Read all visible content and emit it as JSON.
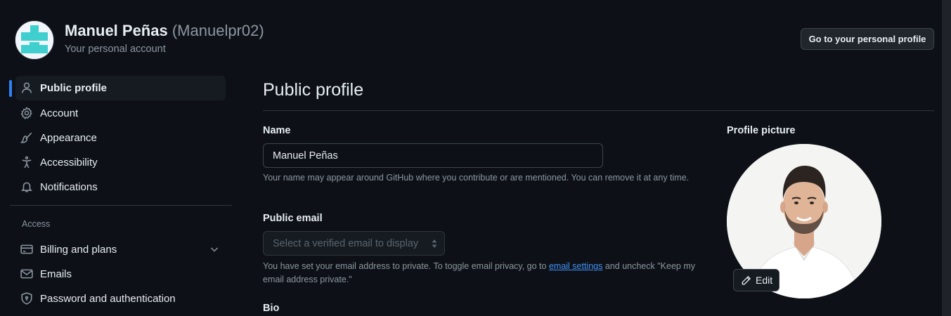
{
  "account": {
    "display_name": "Manuel Peñas",
    "login": "(Manuelpr02)",
    "subtitle": "Your personal account",
    "go_to_profile_label": "Go to your personal profile"
  },
  "sidebar": {
    "items": [
      {
        "label": "Public profile",
        "icon": "person-icon",
        "active": true
      },
      {
        "label": "Account",
        "icon": "gear-icon"
      },
      {
        "label": "Appearance",
        "icon": "paintbrush-icon"
      },
      {
        "label": "Accessibility",
        "icon": "accessibility-icon"
      },
      {
        "label": "Notifications",
        "icon": "bell-icon"
      }
    ],
    "access_heading": "Access",
    "access_items": [
      {
        "label": "Billing and plans",
        "icon": "credit-card-icon",
        "expandable": true
      },
      {
        "label": "Emails",
        "icon": "mail-icon"
      },
      {
        "label": "Password and authentication",
        "icon": "shield-lock-icon"
      }
    ]
  },
  "main": {
    "title": "Public profile",
    "name_label": "Name",
    "name_value": "Manuel Peñas",
    "name_note": "Your name may appear around GitHub where you contribute or are mentioned. You can remove it at any time.",
    "public_email_label": "Public email",
    "public_email_placeholder": "Select a verified email to display",
    "email_note_prefix": "You have set your email address to private. To toggle email privacy, go to ",
    "email_note_link": "email settings",
    "email_note_suffix": " and uncheck \"Keep my email address private.\"",
    "bio_label": "Bio"
  },
  "profile_picture": {
    "label": "Profile picture",
    "edit_label": "Edit"
  },
  "colors": {
    "background": "#0d1117",
    "accent": "#2f81f7",
    "link": "#4493f8",
    "muted_text": "#8d96a0",
    "border": "#30363d"
  }
}
